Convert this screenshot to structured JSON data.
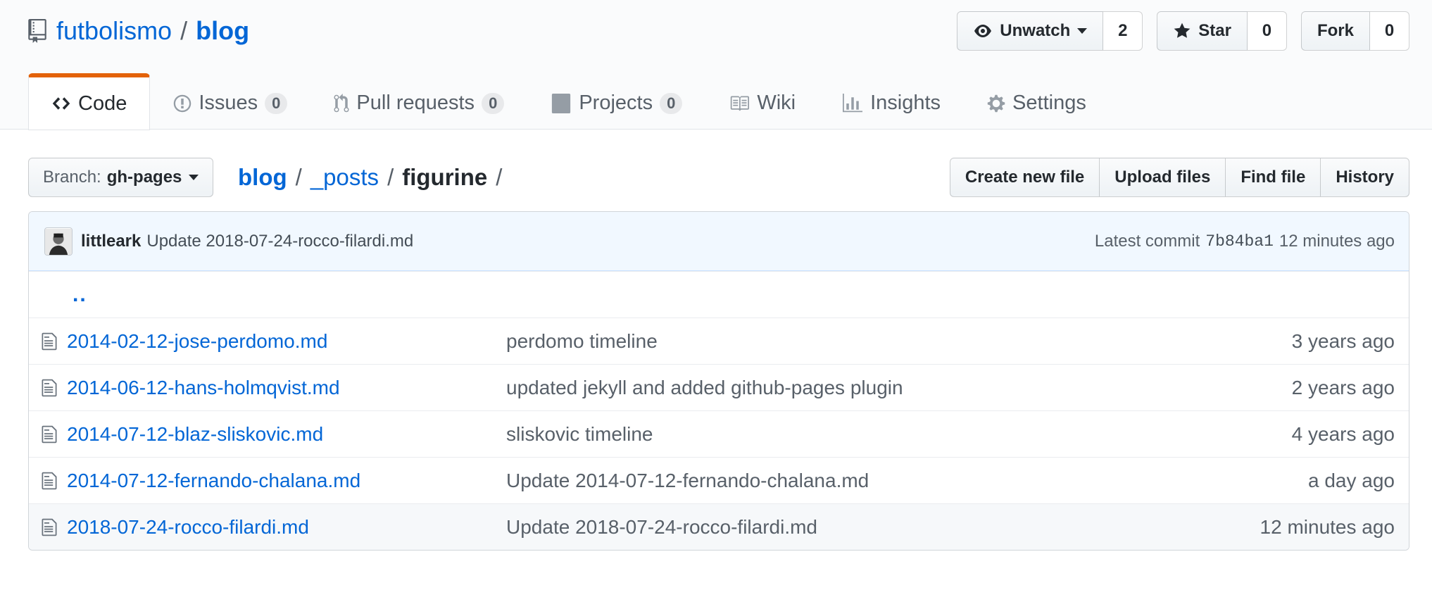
{
  "repo": {
    "owner": "futbolismo",
    "separator": "/",
    "name": "blog"
  },
  "actions": {
    "watch": {
      "label": "Unwatch",
      "count": "2"
    },
    "star": {
      "label": "Star",
      "count": "0"
    },
    "fork": {
      "label": "Fork",
      "count": "0"
    }
  },
  "tabs": [
    {
      "label": "Code",
      "icon": "code-icon",
      "selected": true
    },
    {
      "label": "Issues",
      "icon": "issue-icon",
      "counter": "0"
    },
    {
      "label": "Pull requests",
      "icon": "pull-request-icon",
      "counter": "0"
    },
    {
      "label": "Projects",
      "icon": "project-icon",
      "counter": "0"
    },
    {
      "label": "Wiki",
      "icon": "book-icon"
    },
    {
      "label": "Insights",
      "icon": "graph-icon"
    },
    {
      "label": "Settings",
      "icon": "gear-icon"
    }
  ],
  "branch": {
    "prefix": "Branch:",
    "name": "gh-pages"
  },
  "breadcrumb": {
    "root": "blog",
    "sep": "/",
    "posts": "_posts",
    "current": "figurine",
    "trailing": "/"
  },
  "file_actions": {
    "create": "Create new file",
    "upload": "Upload files",
    "find": "Find file",
    "history": "History"
  },
  "commit": {
    "author": "littleark",
    "message": "Update 2018-07-24-rocco-filardi.md",
    "latest_label": "Latest commit",
    "sha": "7b84ba1",
    "age": "12 minutes ago"
  },
  "up_link": "..",
  "files": [
    {
      "name": "2014-02-12-jose-perdomo.md",
      "message": "perdomo timeline",
      "age": "3 years ago"
    },
    {
      "name": "2014-06-12-hans-holmqvist.md",
      "message": "updated jekyll and added github-pages plugin",
      "age": "2 years ago"
    },
    {
      "name": "2014-07-12-blaz-sliskovic.md",
      "message": "sliskovic timeline",
      "age": "4 years ago"
    },
    {
      "name": "2014-07-12-fernando-chalana.md",
      "message": "Update 2014-07-12-fernando-chalana.md",
      "age": "a day ago"
    },
    {
      "name": "2018-07-24-rocco-filardi.md",
      "message": "Update 2018-07-24-rocco-filardi.md",
      "age": "12 minutes ago"
    }
  ],
  "colors": {
    "link": "#0366d6",
    "selected_tab_accent": "#e36209",
    "commit_bg": "#f1f8ff"
  }
}
